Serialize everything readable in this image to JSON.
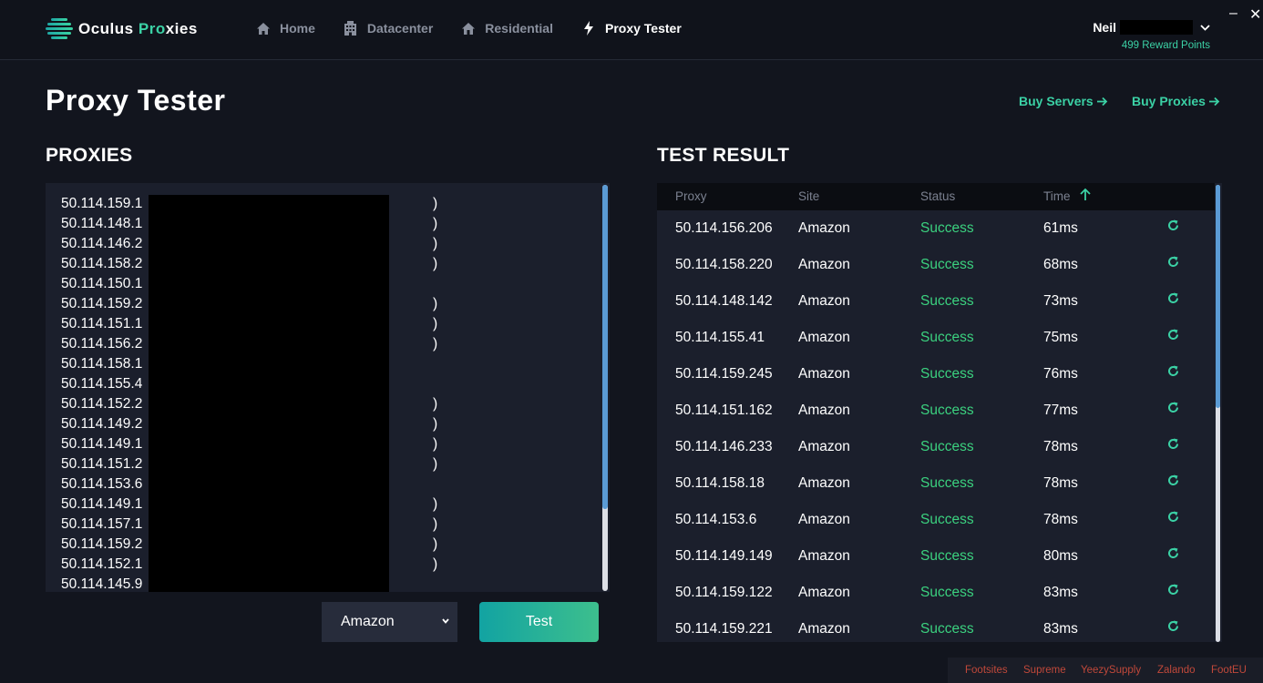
{
  "brand": {
    "name_part1": "Oculus ",
    "name_part2": "Pro",
    "name_part3": "xies"
  },
  "nav": [
    {
      "label": "Home",
      "icon": "home-icon"
    },
    {
      "label": "Datacenter",
      "icon": "building-icon"
    },
    {
      "label": "Residential",
      "icon": "house-icon"
    },
    {
      "label": "Proxy Tester",
      "icon": "lightning-icon"
    }
  ],
  "user": {
    "name": "Neil",
    "points": "499 Reward Points"
  },
  "window": {
    "minimize": "–",
    "close": "✕"
  },
  "page": {
    "title": "Proxy Tester",
    "buy_servers": "Buy Servers",
    "buy_proxies": "Buy Proxies"
  },
  "proxies": {
    "title": "PROXIES",
    "lines": [
      "50.114.159.1",
      "50.114.148.1",
      "50.114.146.2",
      "50.114.158.2",
      "50.114.150.1",
      "50.114.159.2",
      "50.114.151.1",
      "50.114.156.2",
      "50.114.158.1",
      "50.114.155.4",
      "50.114.152.2",
      "50.114.149.2",
      "50.114.149.1",
      "50.114.151.2",
      "50.114.153.6",
      "50.114.149.1",
      "50.114.157.1",
      "50.114.159.2",
      "50.114.152.1",
      "50.114.145.9"
    ],
    "line_tail": ")"
  },
  "controls": {
    "site": "Amazon",
    "test_label": "Test"
  },
  "results": {
    "title": "TEST RESULT",
    "headers": [
      "Proxy",
      "Site",
      "Status",
      "Time"
    ],
    "rows": [
      {
        "proxy": "50.114.156.206",
        "site": "Amazon",
        "status": "Success",
        "time": "61ms"
      },
      {
        "proxy": "50.114.158.220",
        "site": "Amazon",
        "status": "Success",
        "time": "68ms"
      },
      {
        "proxy": "50.114.148.142",
        "site": "Amazon",
        "status": "Success",
        "time": "73ms"
      },
      {
        "proxy": "50.114.155.41",
        "site": "Amazon",
        "status": "Success",
        "time": "75ms"
      },
      {
        "proxy": "50.114.159.245",
        "site": "Amazon",
        "status": "Success",
        "time": "76ms"
      },
      {
        "proxy": "50.114.151.162",
        "site": "Amazon",
        "status": "Success",
        "time": "77ms"
      },
      {
        "proxy": "50.114.146.233",
        "site": "Amazon",
        "status": "Success",
        "time": "78ms"
      },
      {
        "proxy": "50.114.158.18",
        "site": "Amazon",
        "status": "Success",
        "time": "78ms"
      },
      {
        "proxy": "50.114.153.6",
        "site": "Amazon",
        "status": "Success",
        "time": "78ms"
      },
      {
        "proxy": "50.114.149.149",
        "site": "Amazon",
        "status": "Success",
        "time": "80ms"
      },
      {
        "proxy": "50.114.159.122",
        "site": "Amazon",
        "status": "Success",
        "time": "83ms"
      },
      {
        "proxy": "50.114.159.221",
        "site": "Amazon",
        "status": "Success",
        "time": "83ms"
      }
    ]
  },
  "footer": [
    "Footsites",
    "Supreme",
    "YeezySupply",
    "Zalando",
    "FootEU"
  ],
  "colors": {
    "accent": "#3bd1a5",
    "success": "#3bd17f",
    "footer_link": "#c0483a",
    "background": "#12151e",
    "panel": "#1b1f2c"
  }
}
